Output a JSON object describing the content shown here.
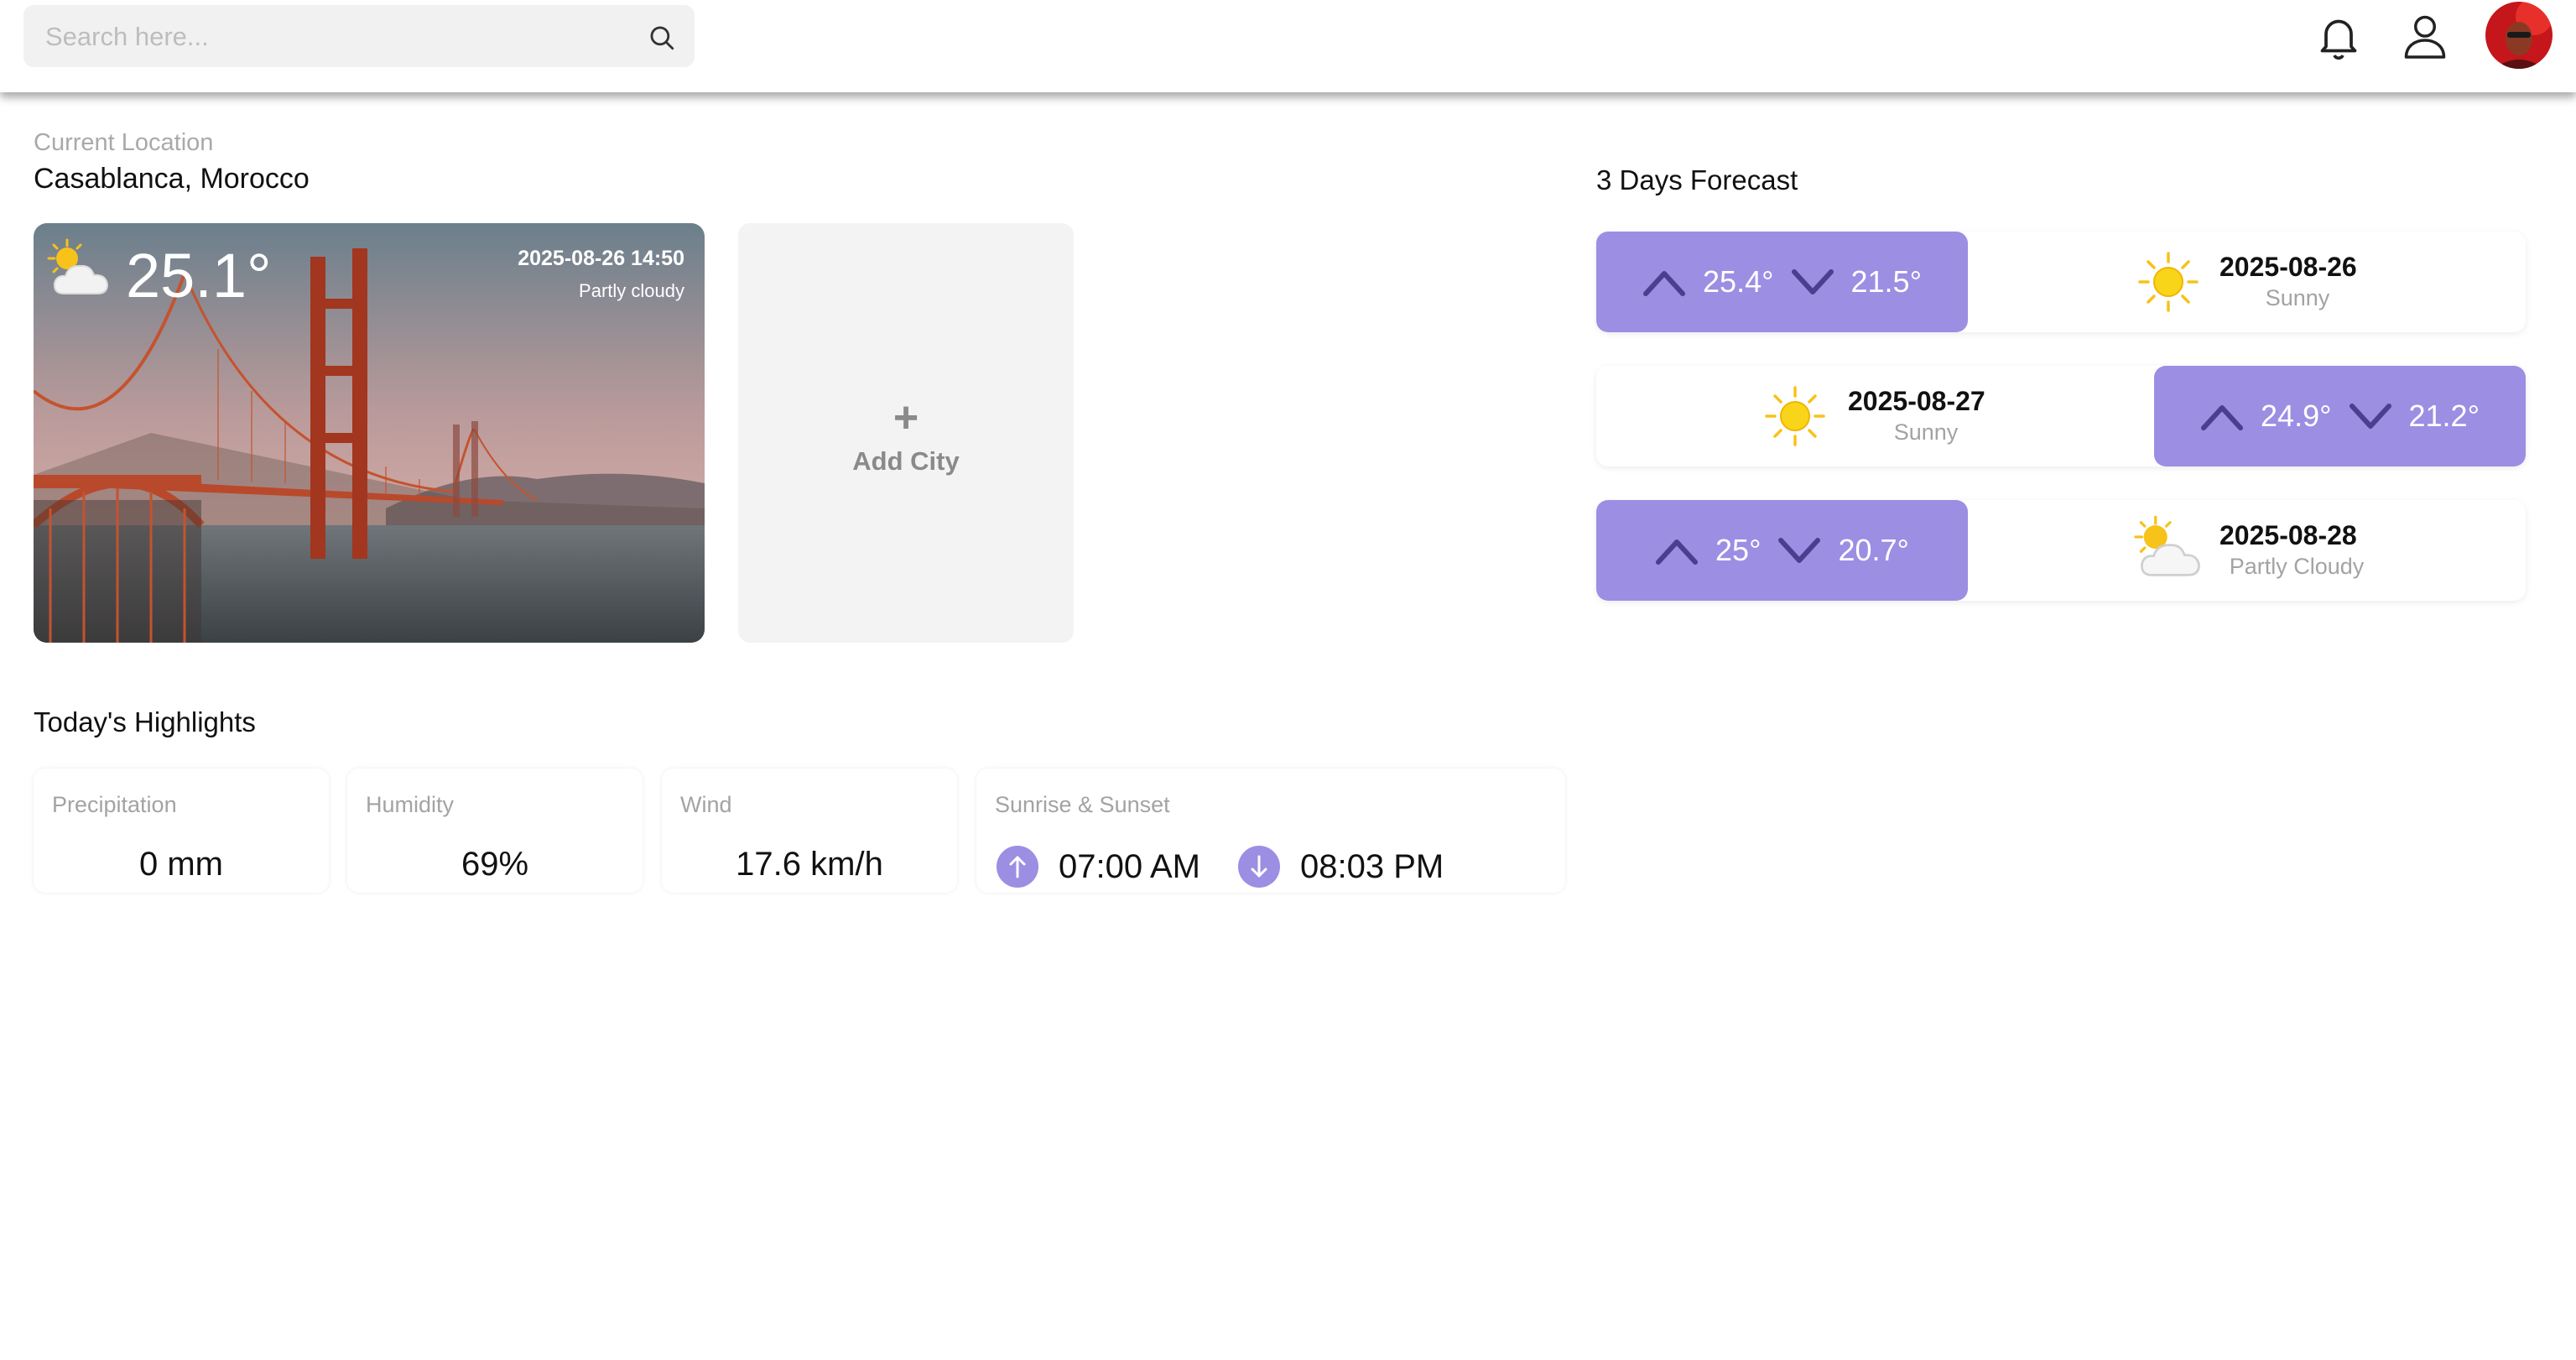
{
  "search": {
    "placeholder": "Search here..."
  },
  "location": {
    "label": "Current Location",
    "name": "Casablanca, Morocco"
  },
  "current": {
    "temp": "25.1°",
    "datetime": "2025-08-26 14:50",
    "condition": "Partly cloudy",
    "icon": "partly-cloudy-icon"
  },
  "add_city": {
    "plus": "+",
    "label": "Add City"
  },
  "highlights": {
    "title": "Today's Highlights",
    "precipitation": {
      "label": "Precipitation",
      "value": "0 mm"
    },
    "humidity": {
      "label": "Humidity",
      "value": "69%"
    },
    "wind": {
      "label": "Wind",
      "value": "17.6 km/h"
    },
    "sun": {
      "label": "Sunrise & Sunset",
      "sunrise": "07:00 AM",
      "sunset": "08:03 PM"
    }
  },
  "forecast": {
    "title": "3 Days Forecast",
    "days": [
      {
        "high": "25.4°",
        "low": "21.5°",
        "date": "2025-08-26",
        "condition": "Sunny",
        "icon": "sun-icon"
      },
      {
        "high": "24.9°",
        "low": "21.2°",
        "date": "2025-08-27",
        "condition": "Sunny",
        "icon": "sun-icon"
      },
      {
        "high": "25°",
        "low": "20.7°",
        "date": "2025-08-28",
        "condition": "Partly Cloudy",
        "icon": "partly-cloudy-icon"
      }
    ]
  },
  "colors": {
    "accent": "#9c8ee3",
    "accent_dark": "#4a3f8f",
    "sun": "#f7c21a"
  }
}
